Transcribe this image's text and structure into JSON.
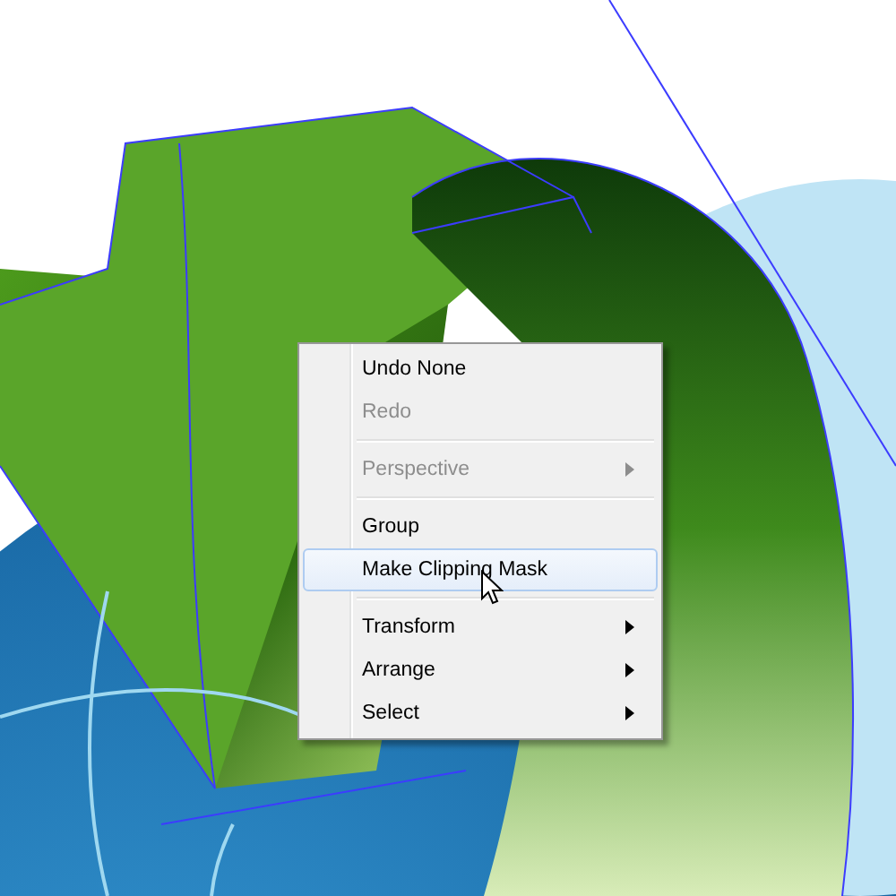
{
  "context_menu": {
    "items": [
      {
        "kind": "item",
        "label": "Undo None",
        "disabled": false,
        "selected": false,
        "submenu": false
      },
      {
        "kind": "item",
        "label": "Redo",
        "disabled": true,
        "selected": false,
        "submenu": false
      },
      {
        "kind": "separator"
      },
      {
        "kind": "item",
        "label": "Perspective",
        "disabled": true,
        "selected": false,
        "submenu": true
      },
      {
        "kind": "separator"
      },
      {
        "kind": "item",
        "label": "Group",
        "disabled": false,
        "selected": false,
        "submenu": false
      },
      {
        "kind": "item",
        "label": "Make Clipping Mask",
        "disabled": false,
        "selected": true,
        "submenu": false
      },
      {
        "kind": "separator"
      },
      {
        "kind": "item",
        "label": "Transform",
        "disabled": false,
        "selected": false,
        "submenu": true
      },
      {
        "kind": "item",
        "label": "Arrange",
        "disabled": false,
        "selected": false,
        "submenu": true
      },
      {
        "kind": "item",
        "label": "Select",
        "disabled": false,
        "selected": false,
        "submenu": true
      }
    ]
  }
}
